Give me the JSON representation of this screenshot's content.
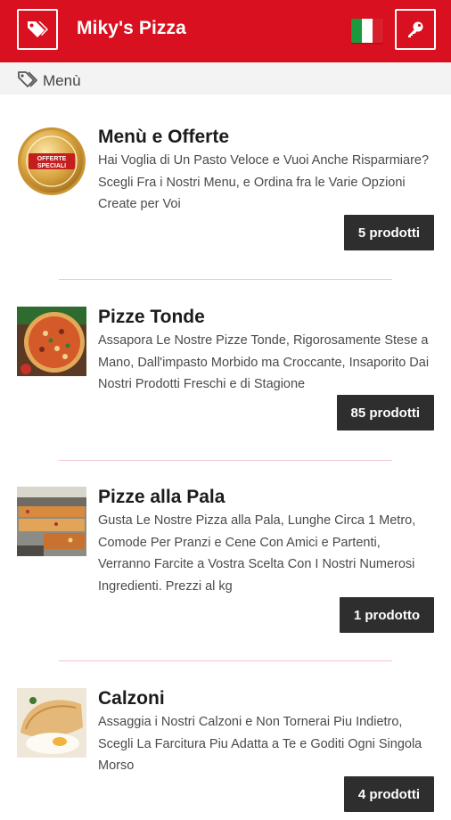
{
  "appbar": {
    "title": "Miky's Pizza",
    "tag_icon": "tag-icon",
    "key_icon": "key-icon",
    "flag": "italy-flag",
    "accent": "#d8101f"
  },
  "breadcrumb": {
    "label": "Menù",
    "icon": "tag-outline-icon"
  },
  "categories": [
    {
      "title": "Menù e Offerte",
      "description": "Hai Voglia di Un Pasto Veloce e Vuoi Anche Risparmiare? Scegli Fra i Nostri Menu, e Ordina fra le Varie Opzioni Create per Voi",
      "count": "5 prodotti",
      "badge_text": "OFFERTE SPECIALI"
    },
    {
      "title": "Pizze Tonde",
      "description": "Assapora Le Nostre Pizze Tonde, Rigorosamente Stese a Mano, Dall'impasto Morbido ma Croccante, Insaporito Dai Nostri Prodotti Freschi e di Stagione",
      "count": "85 prodotti"
    },
    {
      "title": "Pizze alla Pala",
      "description": "Gusta Le Nostre Pizza alla Pala, Lunghe Circa 1 Metro, Comode Per Pranzi e Cene Con Amici e Partenti, Verranno Farcite a Vostra Scelta Con I Nostri Numerosi Ingredienti. Prezzi al kg",
      "count": "1 prodotto"
    },
    {
      "title": "Calzoni",
      "description": "Assaggia i Nostri Calzoni e Non Tornerai Piu Indietro, Scegli La Farcitura Piu Adatta a Te e Goditi Ogni Singola Morso",
      "count": "4 prodotti"
    }
  ]
}
